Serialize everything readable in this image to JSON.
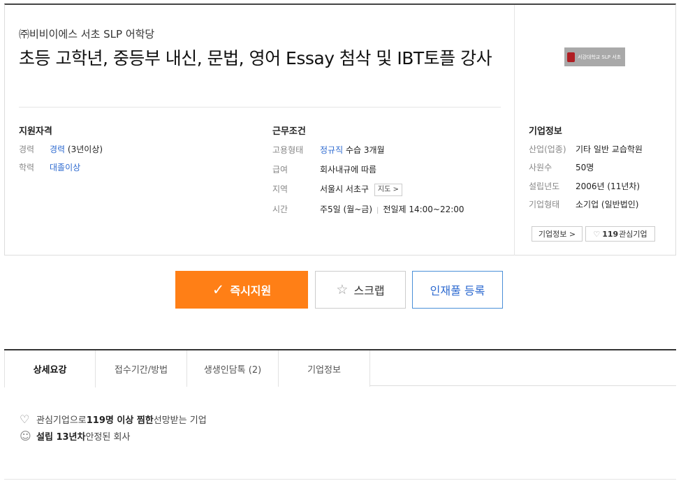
{
  "header": {
    "company": "㈜비비이에스 서초 SLP 어학당",
    "title": "초등 고학년, 중등부 내신, 문법, 영어 Essay 첨삭 및 IBT토플 강사"
  },
  "qualification": {
    "heading": "지원자격",
    "rows": [
      {
        "label": "경력",
        "link": "경력",
        "value": "(3년이상)"
      },
      {
        "label": "학력",
        "link": "대졸이상",
        "value": ""
      }
    ]
  },
  "conditions": {
    "heading": "근무조건",
    "employment": {
      "label": "고용형태",
      "link": "정규직",
      "value": "수습 3개월"
    },
    "salary": {
      "label": "급여",
      "value": "회사내규에 따름"
    },
    "location": {
      "label": "지역",
      "value": "서울시 서초구",
      "map_button": "지도 >"
    },
    "hours": {
      "label": "시간",
      "value1": "주5일 (월~금)",
      "value2": "전일제 14:00~22:00"
    }
  },
  "company_info": {
    "heading": "기업정보",
    "logo_text": "서강대학교 SLP 서초",
    "rows": [
      {
        "label": "산업(업종)",
        "value": "기타 일반 교습학원"
      },
      {
        "label": "사원수",
        "value": "50명"
      },
      {
        "label": "설립년도",
        "value": "2006년 (11년차)"
      },
      {
        "label": "기업형태",
        "value": "소기업 (일반법인)"
      }
    ],
    "info_button": "기업정보 >",
    "favorite_count": "119",
    "favorite_label": "관심기업"
  },
  "actions": {
    "apply": "즉시지원",
    "scrap": "스크랩",
    "talent_pool": "인재풀 등록"
  },
  "tabs": [
    "상세요강",
    "접수기간/방법",
    "생생인담톡 (2)",
    "기업정보"
  ],
  "perks": [
    {
      "pre": "관심기업으로 ",
      "bold": "119명 이상 찜한",
      "post": " 선망받는 기업"
    },
    {
      "pre": "",
      "bold": "설립 13년차",
      "post": " 안정된 회사"
    }
  ],
  "colors": {
    "accent": "#ff7f16",
    "link": "#2d6ad0"
  }
}
